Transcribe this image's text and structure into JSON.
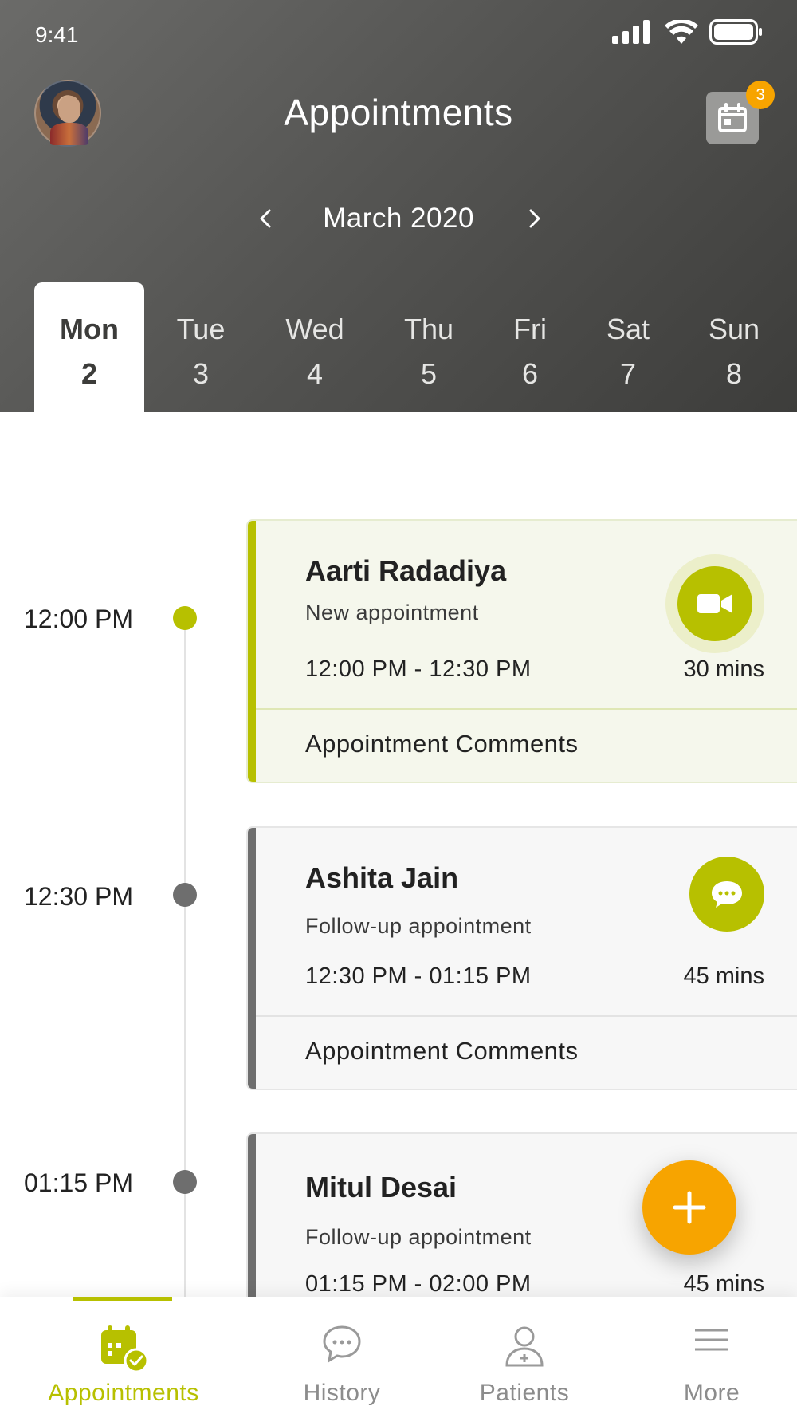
{
  "status_bar": {
    "time": "9:41"
  },
  "header": {
    "title": "Appointments",
    "notification_count": "3",
    "month": "March 2020",
    "days": [
      {
        "name": "Mon",
        "num": "2",
        "active": true
      },
      {
        "name": "Tue",
        "num": "3"
      },
      {
        "name": "Wed",
        "num": "4"
      },
      {
        "name": "Thu",
        "num": "5"
      },
      {
        "name": "Fri",
        "num": "6"
      },
      {
        "name": "Sat",
        "num": "7"
      },
      {
        "name": "Sun",
        "num": "8"
      }
    ]
  },
  "timeline": [
    {
      "time": "12:00 PM",
      "active": true
    },
    {
      "time": "12:30 PM"
    },
    {
      "time": "01:15 PM"
    }
  ],
  "appointments": [
    {
      "name": "Aarti Radadiya",
      "type": "New appointment",
      "range": "12:00 PM - 12:30 PM",
      "duration": "30 mins",
      "comments": "Appointment Comments",
      "action": "video-icon"
    },
    {
      "name": "Ashita Jain",
      "type": "Follow-up appointment",
      "range": "12:30 PM - 01:15 PM",
      "duration": "45 mins",
      "comments": "Appointment Comments",
      "action": "chat-icon"
    },
    {
      "name": "Mitul Desai",
      "type": "Follow-up appointment",
      "range": "01:15 PM - 02:00 PM",
      "duration": "45 mins"
    }
  ],
  "bottom_nav": [
    {
      "label": "Appointments",
      "icon": "calendar-check-icon",
      "active": true
    },
    {
      "label": "History",
      "icon": "chat-bubble-icon"
    },
    {
      "label": "Patients",
      "icon": "patient-icon"
    },
    {
      "label": "More",
      "icon": "menu-icon"
    }
  ],
  "colors": {
    "accent": "#b7c000",
    "fab": "#f7a400",
    "header_dark": "#3d3d3b"
  }
}
